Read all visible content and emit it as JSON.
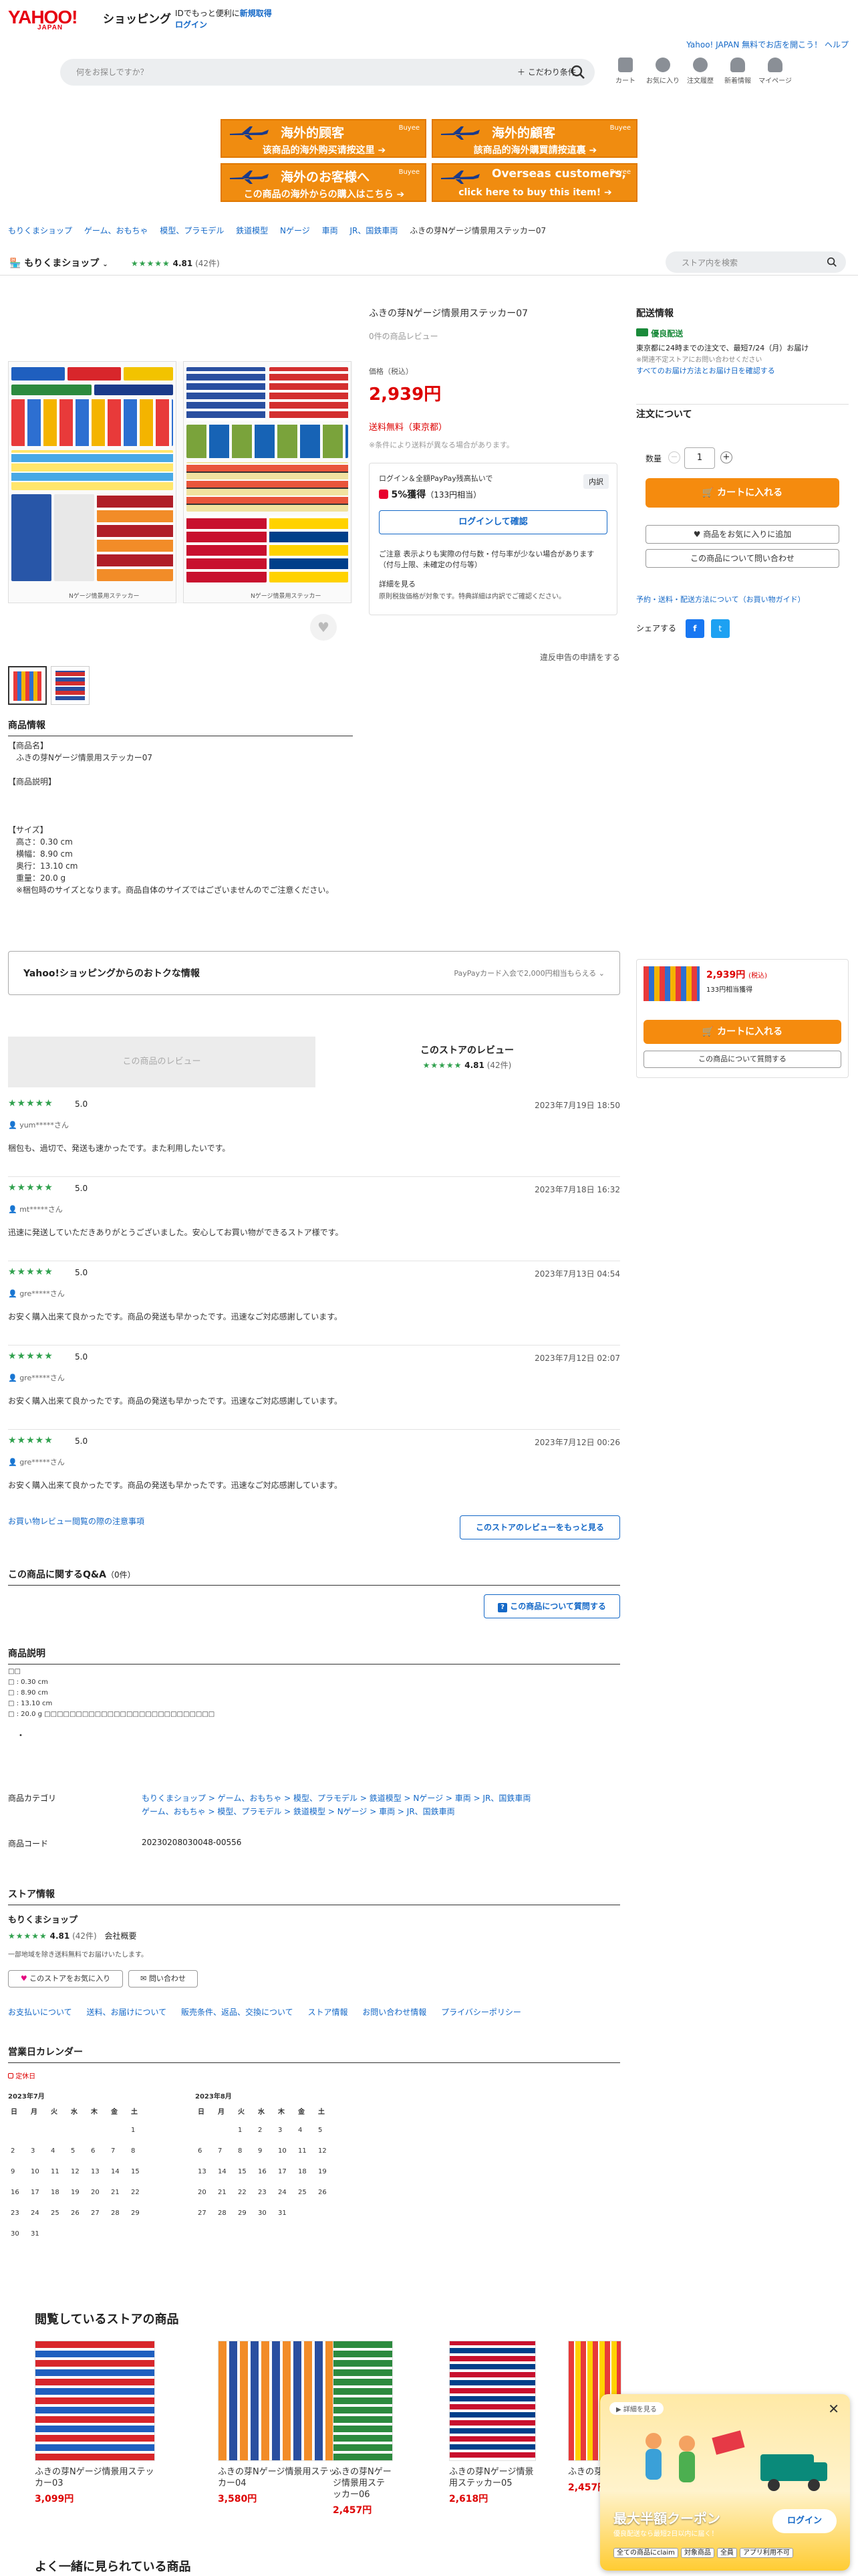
{
  "header": {
    "logo_main": "YAHOO!",
    "logo_sub": "JAPAN",
    "shopping": "ショッピング",
    "promo_text": "IDでもっと便利に",
    "promo_link": "新規取得",
    "login": "ログイン",
    "right_link": "Yahoo! JAPAN 無料でお店を開こう！ ヘルプ"
  },
  "search": {
    "placeholder": "何をお探しですか？",
    "filter": "こだわり条件"
  },
  "top_icons": [
    "カート",
    "お気に入り",
    "注文履歴",
    "新着情報",
    "マイページ"
  ],
  "banners": [
    {
      "title": "海外的顾客",
      "sub": "该商品的海外购买请按这里 ➔",
      "brand": "Buyee"
    },
    {
      "title": "海外的顧客",
      "sub": "該商品的海外購買請按這裏 ➔",
      "brand": "Buyee"
    },
    {
      "title": "海外のお客様へ",
      "sub": "この商品の海外からの購入はこちら ➔",
      "brand": "Buyee"
    },
    {
      "title": "Overseas customers,",
      "sub": "click here to buy this item! ➔",
      "brand": "Buyee"
    }
  ],
  "breadcrumb": [
    "もりくまショップ",
    "ゲーム、おもちゃ",
    "模型、プラモデル",
    "鉄道模型",
    "Nゲージ",
    "車両",
    "JR、国鉄車両",
    "ふきの芽Nゲージ情景用ステッカー07"
  ],
  "store": {
    "name": "もりくまショップ",
    "stars": "★★★★★",
    "rating": "4.81",
    "review_count": "(42件)",
    "search_placeholder": "ストア内を検索"
  },
  "product": {
    "title": "ふきの芽Nゲージ情景用ステッカー07",
    "reviews": "0件の商品レビュー",
    "price_label": "価格（税込）",
    "price": "2,939円",
    "shipping": "送料無料（東京都）",
    "shipping_note": "※条件により送料が異なる場合があります。",
    "point_head": "ログイン＆全額PayPay残高払いで",
    "point_rate": "5%獲得",
    "point_equiv": "（133円相当）",
    "point_breakdown": "内訳",
    "login_confirm": "ログインして確認",
    "caution": "ご注意 表示よりも実際の付与数・付与率が少ない場合があります（付与上限、未確定の付与等）",
    "detail_link": "詳細を見る",
    "detail_note": "原則税抜価格が対象です。特典詳細は内訳でご確認ください。",
    "report": "違反申告の申請をする",
    "image_caption_1": "Nゲージ情景用ステッカー",
    "image_caption_2": "Nゲージ情景用ステッカー"
  },
  "delivery": {
    "title": "配送情報",
    "badge": "優良配送",
    "line1": "東京都に24時までの注文で、最短7/24（月）お届け",
    "line2": "※関連不定ストアにお問い合わせください",
    "link": "すべてのお届け方法とお届け日を確認する"
  },
  "order": {
    "title": "注文について",
    "qty_label": "数量",
    "qty": "1",
    "cart": "カートに入れる",
    "fav": "商品をお気に入りに追加",
    "ask": "この商品について問い合わせ",
    "links": "予約・送料・配送方法について（お買い物ガイド）",
    "share": "シェアする"
  },
  "spec": {
    "title": "商品情報",
    "lines": [
      "【商品名】",
      "　ふきの芽Nゲージ情景用ステッカー07",
      "",
      "【商品説明】",
      "",
      "",
      "",
      "【サイズ】",
      "　高さ：0.30 cm",
      "　横幅：8.90 cm",
      "　奥行：13.10 cm",
      "　重量：20.0 g",
      "　※梱包時のサイズとなります。商品自体のサイズではございませんのでご注意ください。"
    ]
  },
  "deals": {
    "title": "Yahoo!ショッピングからのおトクな情報",
    "note": "PayPayカード入会で2,000円相当もらえる"
  },
  "sticky": {
    "price": "2,939円",
    "tax": "(税込)",
    "points": "133円相当獲得",
    "cart": "カートに入れる",
    "ask": "この商品について質問する"
  },
  "reviews": {
    "tab_product": "この商品のレビュー",
    "tab_store": "このストアのレビュー",
    "store_stars": "★★★★★",
    "store_rating": "4.81",
    "store_count": "(42件)",
    "items": [
      {
        "stars": "★★★★★",
        "score": "5.0",
        "date": "2023年7月19日 18:50",
        "user": "yum*****さん",
        "body": "梱包も、過切で、発送も速かったです。また利用したいです。"
      },
      {
        "stars": "★★★★★",
        "score": "5.0",
        "date": "2023年7月18日 16:32",
        "user": "mt*****さん",
        "body": "迅速に発送していただきありがとうございました。安心してお買い物ができるストア様です。"
      },
      {
        "stars": "★★★★★",
        "score": "5.0",
        "date": "2023年7月13日 04:54",
        "user": "gre*****さん",
        "body": "お安く購入出来て良かったです。商品の発送も早かったです。迅速なご対応感謝しています。"
      },
      {
        "stars": "★★★★★",
        "score": "5.0",
        "date": "2023年7月12日 02:07",
        "user": "gre*****さん",
        "body": "お安く購入出来て良かったです。商品の発送も早かったです。迅速なご対応感謝しています。"
      },
      {
        "stars": "★★★★★",
        "score": "5.0",
        "date": "2023年7月12日 00:26",
        "user": "gre*****さん",
        "body": "お安く購入出来て良かったです。商品の発送も早かったです。迅速なご対応感謝しています。"
      }
    ],
    "notice_link": "お買い物レビュー閲覧の際の注意事項",
    "more": "このストアのレビューをもっと見る"
  },
  "qa": {
    "title": "この商品に関するQ&A",
    "count": "（0件）",
    "ask": "この商品について質問する"
  },
  "desc": {
    "title": "商品説明",
    "lines": [
      "□□",
      "□ : 0.30 cm",
      "□ : 8.90 cm",
      "□ : 13.10 cm",
      "□ : 20.0 g □□□□□□□□□□□□□□□□□□□□□□□□□□□",
      "",
      "•"
    ]
  },
  "category": {
    "label": "商品カテゴリ",
    "line1": "もりくまショップ > ゲーム、おもちゃ > 模型、プラモデル > 鉄道模型 > Nゲージ > 車両 > JR、国鉄車両",
    "line2": "ゲーム、おもちゃ > 模型、プラモデル > 鉄道模型 > Nゲージ > 車両 > JR、国鉄車両",
    "code_label": "商品コード",
    "code": "20230208030048-00556"
  },
  "storeinfo": {
    "title": "ストア情報",
    "name": "もりくまショップ",
    "stars": "★★★★★",
    "rating": "4.81",
    "count": "(42件)",
    "profile": "会社概要",
    "note": "一部地域を除き送料無料でお届けいたします。",
    "fav": "このストアをお気に入り",
    "contact": "問い合わせ"
  },
  "footer_links": [
    "お支払いについて",
    "送料、お届けについて",
    "販売条件、返品、交換について",
    "ストア情報",
    "お問い合わせ情報",
    "プライバシーポリシー"
  ],
  "calendar": {
    "title": "営業日カレンダー",
    "legend": "定休日",
    "month1": "2023年7月",
    "month2": "2023年8月",
    "weekdays": [
      "日",
      "月",
      "火",
      "水",
      "木",
      "金",
      "土"
    ],
    "m1": [
      [
        "",
        "",
        "",
        "",
        "",
        "",
        "1"
      ],
      [
        "2",
        "3",
        "4",
        "5",
        "6",
        "7",
        "8"
      ],
      [
        "9",
        "10",
        "11",
        "12",
        "13",
        "14",
        "15"
      ],
      [
        "16",
        "17",
        "18",
        "19",
        "20",
        "21",
        "22"
      ],
      [
        "23",
        "24",
        "25",
        "26",
        "27",
        "28",
        "29"
      ],
      [
        "30",
        "31",
        "",
        "",
        "",
        "",
        ""
      ]
    ],
    "m2": [
      [
        "",
        "",
        "1",
        "2",
        "3",
        "4",
        "5"
      ],
      [
        "6",
        "7",
        "8",
        "9",
        "10",
        "11",
        "12"
      ],
      [
        "13",
        "14",
        "15",
        "16",
        "17",
        "18",
        "19"
      ],
      [
        "20",
        "21",
        "22",
        "23",
        "24",
        "25",
        "26"
      ],
      [
        "27",
        "28",
        "29",
        "30",
        "31",
        "",
        ""
      ]
    ]
  },
  "recent": {
    "title": "閲覧しているストアの商品",
    "items": [
      {
        "name": "ふきの芽Nゲージ情景用ステッカー03",
        "price": "3,099円"
      },
      {
        "name": "ふきの芽Nゲージ情景用ステッカー04",
        "price": "3,580円"
      },
      {
        "name": "ふきの芽Nゲージ情景用ステッカー06",
        "price": "2,457円"
      },
      {
        "name": "ふきの芽Nゲージ情景用ステッカー05",
        "price": "2,618円"
      },
      {
        "name": "ふきの芽",
        "price": "2,457円"
      }
    ]
  },
  "also": {
    "title": "よく一緒に見られている商品"
  },
  "popup": {
    "detail": "詳細を見る",
    "headline": "最大半額クーポン",
    "sub": "優良配送なら最短2日以内に届く！",
    "login": "ログイン",
    "tags": [
      "全ての商品にclaim",
      "対象商品",
      "全員",
      "アプリ利用不可"
    ]
  }
}
